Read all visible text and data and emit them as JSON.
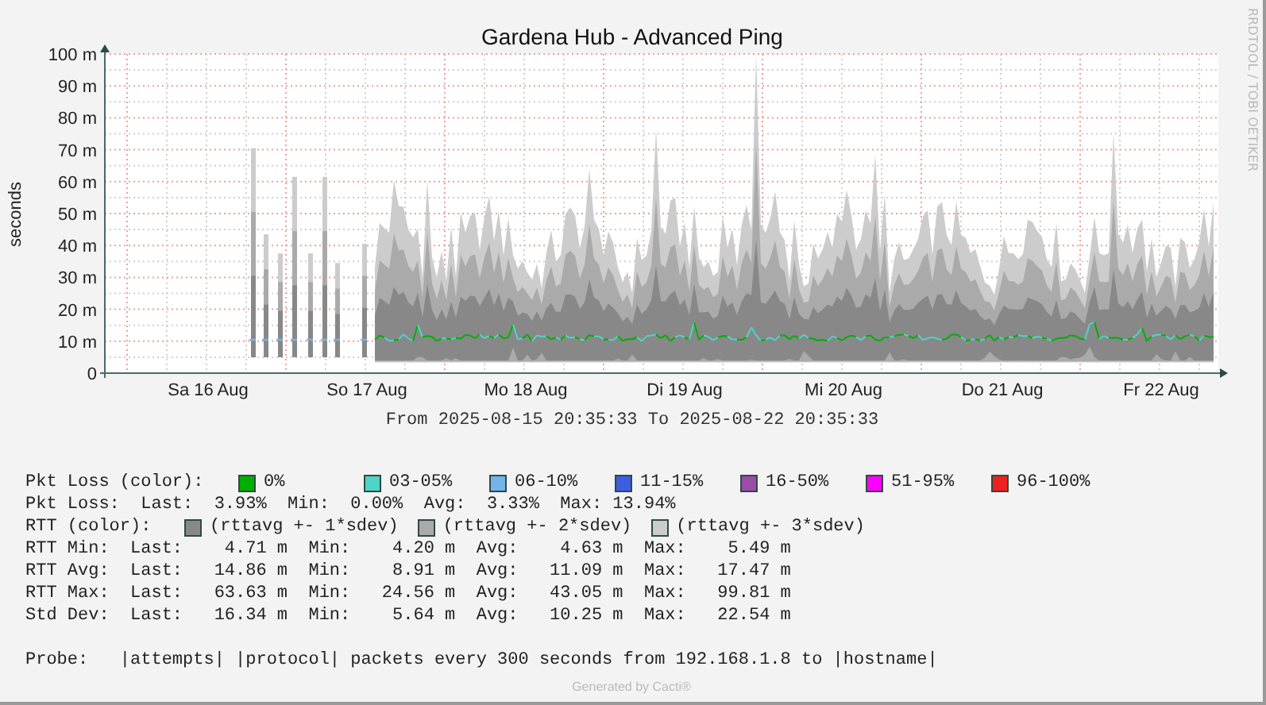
{
  "title": "Gardena Hub - Advanced Ping",
  "credit": "RRDTOOL / TOBI OETIKER",
  "y_axis": {
    "label": "seconds",
    "ticks": [
      "100 m",
      "90 m",
      "80 m",
      "70 m",
      "60 m",
      "50 m",
      "40 m",
      "30 m",
      "20 m",
      "10 m",
      "0"
    ]
  },
  "x_axis": {
    "ticks": [
      "Sa 16 Aug",
      "So 17 Aug",
      "Mo 18 Aug",
      "Di 19 Aug",
      "Mi 20 Aug",
      "Do 21 Aug",
      "Fr 22 Aug"
    ]
  },
  "range": "From 2025-08-15 20:35:33 To 2025-08-22 20:35:33",
  "legend": {
    "loss_colors": {
      "label": "Pkt Loss (color):",
      "items": [
        {
          "label": "0%",
          "color": "#00b000"
        },
        {
          "label": "03-05%",
          "color": "#4fd4c8"
        },
        {
          "label": "06-10%",
          "color": "#74b4e8"
        },
        {
          "label": "11-15%",
          "color": "#3c5ee0"
        },
        {
          "label": "16-50%",
          "color": "#9a4ca6"
        },
        {
          "label": "51-95%",
          "color": "#ff00ff"
        },
        {
          "label": "96-100%",
          "color": "#ee2020"
        }
      ]
    },
    "loss_stats": "Pkt Loss:  Last:  3.93%  Min:  0.00%  Avg:  3.33%  Max: 13.94%",
    "rtt_colors": {
      "label": "RTT (color):",
      "items": [
        {
          "label": "(rttavg +- 1*sdev)",
          "color": "#888888"
        },
        {
          "label": "(rttavg +- 2*sdev)",
          "color": "#aaaaaa"
        },
        {
          "label": "(rttavg +- 3*sdev)",
          "color": "#cccccc"
        }
      ]
    },
    "rtt_stats": [
      "RTT Min:  Last:    4.71 m  Min:    4.20 m  Avg:    4.63 m  Max:    5.49 m",
      "RTT Avg:  Last:   14.86 m  Min:    8.91 m  Avg:   11.09 m  Max:   17.47 m",
      "RTT Max:  Last:   63.63 m  Min:   24.56 m  Avg:   43.05 m  Max:   99.81 m",
      "Std Dev:  Last:   16.34 m  Min:    5.64 m  Avg:   10.25 m  Max:   22.54 m"
    ]
  },
  "probe": "Probe:   |attempts| |protocol| packets every 300 seconds from 192.168.1.8 to |hostname|",
  "footer": "Generated by Cacti®"
}
